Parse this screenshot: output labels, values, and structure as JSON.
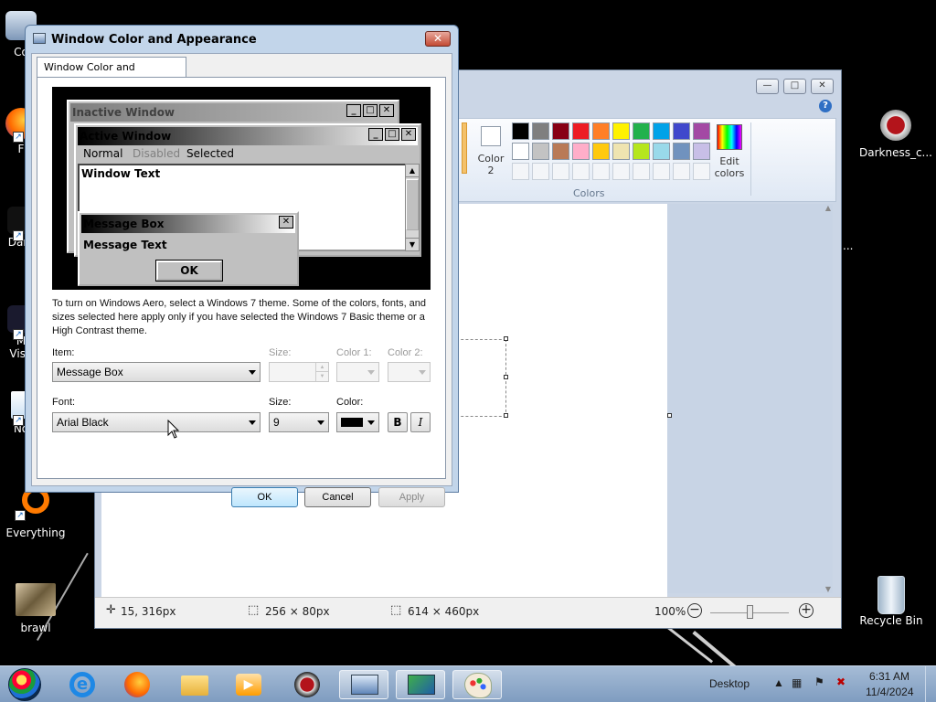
{
  "desktop": {
    "icons": [
      {
        "label": "Co",
        "icon": "computer-icon"
      },
      {
        "label": "F",
        "icon": "firefox-icon"
      },
      {
        "label": "Dark",
        "icon": "darkness-icon"
      },
      {
        "label": "M\nVisu",
        "icon": "visual-studio-icon"
      },
      {
        "label": "No",
        "icon": "notepad-icon"
      },
      {
        "label": "Everything",
        "icon": "everything-icon"
      },
      {
        "label": "brawl",
        "icon": "brawl-image-icon"
      },
      {
        "label": "Darkness_c...",
        "icon": "darkness-chrome-icon"
      },
      {
        "label": "Recycle Bin",
        "icon": "recycle-bin-icon"
      }
    ],
    "stray_text": "..."
  },
  "paint": {
    "window_buttons": [
      "—",
      "□",
      "✕"
    ],
    "help_icon": "?",
    "color2_label": "Color\n2",
    "edit_colors_label": "Edit\ncolors",
    "group_label": "Colors",
    "palette_row1": [
      "#000000",
      "#7f7f7f",
      "#880015",
      "#ed1c24",
      "#ff7f27",
      "#fff200",
      "#22b14c",
      "#00a2e8",
      "#3f48cc",
      "#a349a4"
    ],
    "palette_row2": [
      "#ffffff",
      "#c3c3c3",
      "#b97a57",
      "#ffaec9",
      "#ffc90e",
      "#efe4b0",
      "#b5e61d",
      "#99d9ea",
      "#7092be",
      "#c8bfe7"
    ],
    "status": {
      "cursor_pos": "15, 316px",
      "selection_size": "256 × 80px",
      "image_size": "614 × 460px",
      "zoom": "100%"
    }
  },
  "dialog": {
    "title": "Window Color and Appearance",
    "close_label": "✕",
    "tab_label": "Window Color and Appearance",
    "preview": {
      "inactive_title": "Inactive Window",
      "active_title": "Active Window",
      "menu_normal": "Normal",
      "menu_disabled": "Disabled",
      "menu_selected": "Selected",
      "window_text": "Window Text",
      "message_box_title": "Message Box",
      "message_text": "Message Text",
      "ok_label": "OK"
    },
    "description": "To turn on Windows Aero, select a Windows 7 theme.  Some of the colors, fonts, and sizes selected here apply only if you have selected the Windows 7 Basic theme or a High Contrast theme.",
    "item_label": "Item:",
    "item_value": "Message Box",
    "size_label_1": "Size:",
    "color1_label": "Color 1:",
    "color2_label": "Color 2:",
    "font_label": "Font:",
    "font_value": "Arial Black",
    "size_label_2": "Size:",
    "size_value": "9",
    "color_label": "Color:",
    "font_color": "#000000",
    "bold_label": "B",
    "italic_label": "I",
    "ok_button": "OK",
    "cancel_button": "Cancel",
    "apply_button": "Apply"
  },
  "taskbar": {
    "desktop_label": "Desktop",
    "time": "6:31 AM",
    "date": "11/4/2024",
    "apps": [
      "start-orb-icon",
      "internet-explorer-icon",
      "firefox-icon",
      "file-explorer-icon",
      "media-player-icon",
      "darkness-icon",
      "control-panel-icon",
      "personalization-icon",
      "paint-icon"
    ]
  }
}
